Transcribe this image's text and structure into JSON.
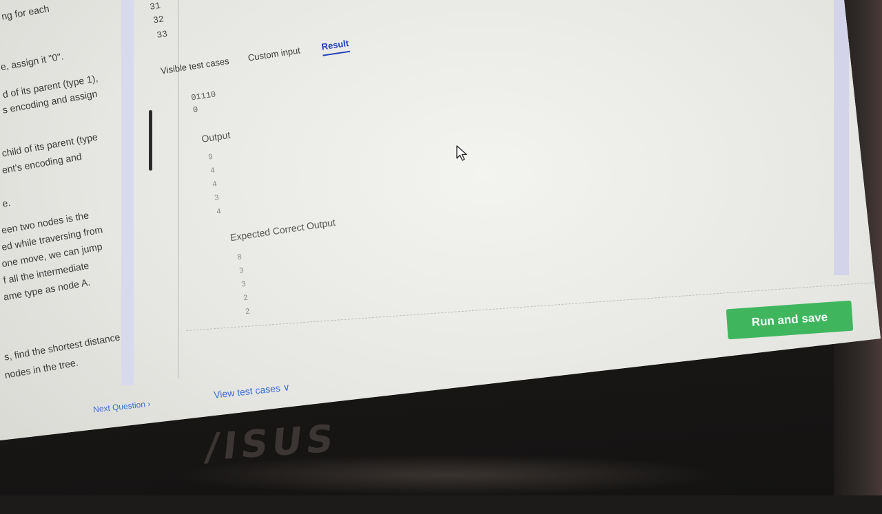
{
  "problem": {
    "lines": [
      "ng for each",
      "e, assign it \"0\".",
      "d of its parent (type 1),",
      "s encoding and assign",
      "child of its parent (type",
      "ent's encoding and",
      "e.",
      "een two nodes is the",
      "ed while traversing from",
      "one move, we can jump",
      "f all the intermediate",
      "ame type as node A.",
      "s, find the shortest distance",
      "nodes in the tree."
    ],
    "next_question": "Next Question"
  },
  "editor": {
    "line_numbers": [
      "31",
      "32",
      "33"
    ]
  },
  "tabs": {
    "visible": "Visible test cases",
    "custom": "Custom input",
    "result": "Result"
  },
  "input": {
    "lines": [
      "01110",
      "0"
    ]
  },
  "output": {
    "label": "Output",
    "values": [
      "9",
      "4",
      "4",
      "3",
      "4"
    ]
  },
  "expected": {
    "label": "Expected Correct Output",
    "values": [
      "8",
      "3",
      "3",
      "2",
      "2"
    ]
  },
  "actions": {
    "run_and_save": "Run and save",
    "view_test_cases": "View test cases"
  },
  "brand": {
    "logo_text": "/ISUS"
  },
  "colors": {
    "accent_link": "#2442b8",
    "run_button": "#3fb65e"
  }
}
